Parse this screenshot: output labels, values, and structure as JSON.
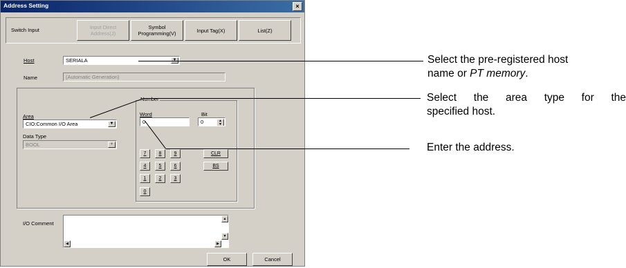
{
  "window": {
    "title": "Address Setting",
    "close_glyph": "×"
  },
  "tabs": {
    "label": "Switch Input",
    "buttons": [
      {
        "label": "Input Direct\nAddress(J)",
        "enabled": false
      },
      {
        "label": "Symbol\nProgramming(V)",
        "enabled": true
      },
      {
        "label": "Input Tag(X)",
        "enabled": true
      },
      {
        "label": "List(Z)",
        "enabled": true
      }
    ]
  },
  "host": {
    "label": "Host",
    "value": "SERIALA"
  },
  "name": {
    "label": "Name",
    "value": "(Automatic Generation)"
  },
  "area": {
    "label": "Area",
    "value": "CIO:Common I/O Area"
  },
  "data_type": {
    "label": "Data Type",
    "value": "BOOL"
  },
  "number": {
    "group_label": "Number",
    "word_label": "Word",
    "word_value": "0",
    "bit_label": "Bit",
    "bit_value": "0"
  },
  "keypad": {
    "keys": [
      "7",
      "8",
      "9",
      "4",
      "5",
      "6",
      "1",
      "2",
      "3",
      "0"
    ],
    "clr": "CLR",
    "bs": "BS"
  },
  "io_comment": {
    "label": "I/O Comment",
    "value": ""
  },
  "ok_label": "OK",
  "cancel_label": "Cancel",
  "annotations": {
    "a1_line1": "Select the pre-registered host",
    "a1_line2_prefix": "name or ",
    "a1_line2_italic": "PT memory",
    "a1_line2_suffix": ".",
    "a2_line1": "Select the area type for the",
    "a2_line2": "specified host.",
    "a3": "Enter the address."
  },
  "colors": {
    "dialog_bg": "#d4d0c8",
    "titlebar": "#0a246a"
  }
}
